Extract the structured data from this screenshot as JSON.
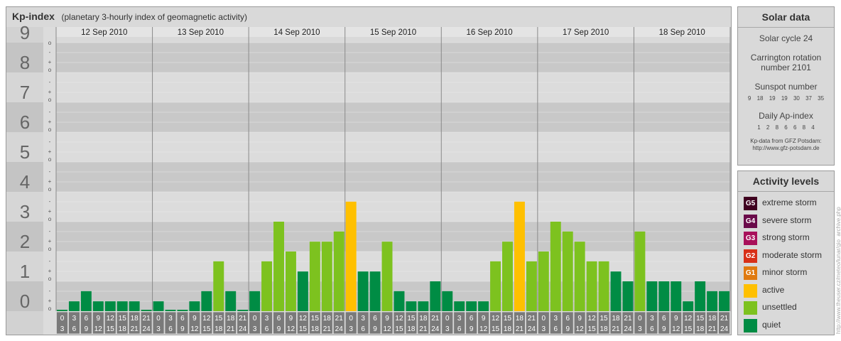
{
  "header": {
    "title": "Kp-index",
    "subtitle": "(planetary 3-hourly index of geomagnetic activity)"
  },
  "colors": {
    "quiet": "#008c44",
    "unsettled": "#7dc21f",
    "active": "#ffc000",
    "g1": "#e07a10",
    "g2": "#d83018",
    "g3": "#a8105a",
    "g4": "#6a0a4a",
    "g5": "#400020",
    "band_dark": "#c8c8c8",
    "band_light": "#dcdcdc",
    "hour_box": "#7a7a7a"
  },
  "chart_data": {
    "type": "bar",
    "title": "Kp-index",
    "ylim": [
      0,
      9
    ],
    "y_ticks": [
      "0",
      "1",
      "2",
      "3",
      "4",
      "5",
      "6",
      "7",
      "8",
      "9"
    ],
    "sub_ticks": [
      "-",
      "o",
      "+"
    ],
    "days": [
      "12 Sep 2010",
      "13 Sep 2010",
      "14 Sep 2010",
      "15 Sep 2010",
      "16 Sep 2010",
      "17 Sep 2010",
      "18 Sep 2010"
    ],
    "hour_start": [
      "0",
      "3",
      "6",
      "9",
      "12",
      "15",
      "18",
      "21"
    ],
    "hour_end": [
      "3",
      "6",
      "9",
      "12",
      "15",
      "18",
      "21",
      "24"
    ],
    "values": [
      0.0,
      0.33,
      0.67,
      0.33,
      0.33,
      0.33,
      0.33,
      0.0,
      0.33,
      0.0,
      0.0,
      0.33,
      0.67,
      1.67,
      0.67,
      0.0,
      0.67,
      1.67,
      3.0,
      2.0,
      1.33,
      2.33,
      2.33,
      2.67,
      3.67,
      1.33,
      1.33,
      2.33,
      0.67,
      0.33,
      0.33,
      1.0,
      0.67,
      0.33,
      0.33,
      0.33,
      1.67,
      2.33,
      3.67,
      1.67,
      2.0,
      3.0,
      2.67,
      2.33,
      1.67,
      1.67,
      1.33,
      1.0,
      2.67,
      1.0,
      1.0,
      1.0,
      0.33,
      1.0,
      0.67,
      0.67
    ]
  },
  "solar": {
    "title": "Solar data",
    "cycle": "Solar cycle 24",
    "carrington_1": "Carrington rotation",
    "carrington_2": "number 2101",
    "sunspot_title": "Sunspot number",
    "sunspot_values": "9 18 19 19 30 37 35",
    "ap_title": "Daily Ap-index",
    "ap_values": "1 2 8 6 6 8 4",
    "source_1": "Kp-data from GFZ Potsdam:",
    "source_2": "http://www.gfz-potsdam.de"
  },
  "levels": {
    "title": "Activity levels",
    "items": [
      {
        "code": "G5",
        "label": "extreme storm",
        "color": "#400020"
      },
      {
        "code": "G4",
        "label": "severe storm",
        "color": "#6a0a4a"
      },
      {
        "code": "G3",
        "label": "strong storm",
        "color": "#a8105a"
      },
      {
        "code": "G2",
        "label": "moderate storm",
        "color": "#d83018"
      },
      {
        "code": "G1",
        "label": "minor storm",
        "color": "#e07a10"
      },
      {
        "code": "",
        "label": "active",
        "color": "#ffc000"
      },
      {
        "code": "",
        "label": "unsettled",
        "color": "#7dc21f"
      },
      {
        "code": "",
        "label": "quiet",
        "color": "#008c44"
      }
    ]
  },
  "credit": "http://www.theuser.cz/meteo/lunar/gio_archive.php"
}
